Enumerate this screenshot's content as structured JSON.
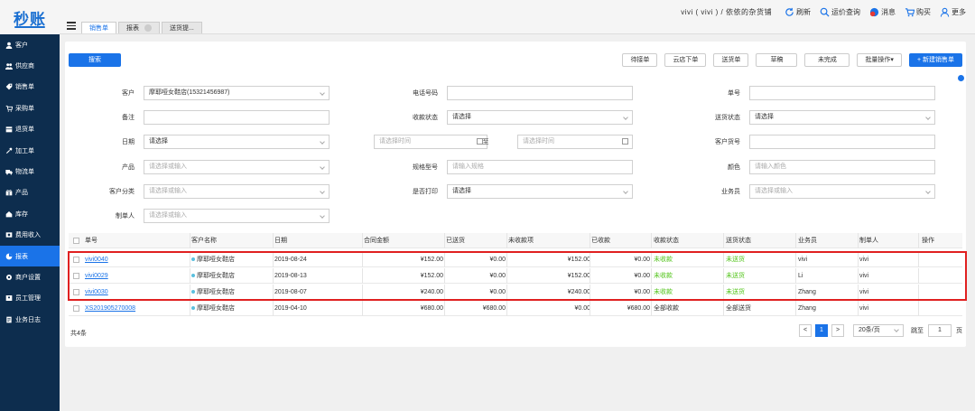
{
  "app": {
    "logo": "秒账",
    "tabs": [
      {
        "label": "销售单"
      },
      {
        "label": "报表"
      },
      {
        "label": "送货提..."
      }
    ]
  },
  "topbar": {
    "user": "vivi ( vivi ) / 依依的杂货铺",
    "refresh": "刷新",
    "freight": "运价查询",
    "messages": "消息",
    "cart": "购买",
    "more": "更多"
  },
  "sidebar": {
    "items": [
      {
        "label": "客户",
        "icon": "user-icon"
      },
      {
        "label": "供应商",
        "icon": "users-icon"
      },
      {
        "label": "销售单",
        "icon": "tag-icon"
      },
      {
        "label": "采购单",
        "icon": "cart-icon"
      },
      {
        "label": "退货单",
        "icon": "box-icon"
      },
      {
        "label": "加工单",
        "icon": "tool-icon"
      },
      {
        "label": "物流单",
        "icon": "truck-icon"
      },
      {
        "label": "产品",
        "icon": "gift-icon"
      },
      {
        "label": "库存",
        "icon": "home-icon"
      },
      {
        "label": "费用收入",
        "icon": "money-icon"
      },
      {
        "label": "报表",
        "icon": "chart-icon"
      },
      {
        "label": "商户设置",
        "icon": "gear-icon"
      },
      {
        "label": "员工管理",
        "icon": "staff-icon"
      },
      {
        "label": "业务日志",
        "icon": "log-icon"
      }
    ],
    "active_index": 10
  },
  "toolbar": {
    "search": "搜索",
    "pending": "待接单",
    "cloud": "云店下单",
    "delivery": "送货单",
    "draft": "草稿",
    "unfinished": "未完成",
    "batch": "批量操作▾",
    "create": "+ 新建销售单"
  },
  "filters": {
    "customer_label": "客户",
    "customer_value": "摩耶哑女鞋店(15321456987)",
    "phone_label": "电话号码",
    "order_label": "单号",
    "remark_label": "备注",
    "payment_label": "收款状态",
    "payment_value": "请选择",
    "delivery_label": "送货状态",
    "delivery_value": "请选择",
    "date_label": "日期",
    "date_value": "请选择",
    "start_placeholder": "请选择时间",
    "to": "至",
    "end_placeholder": "请选择时间",
    "cust_order_label": "客户货号",
    "product_label": "产品",
    "product_placeholder": "请选择或输入",
    "spec_label": "规格型号",
    "spec_placeholder": "请输入规格",
    "color_label": "颜色",
    "color_placeholder": "请输入颜色",
    "category_label": "客户分类",
    "category_placeholder": "请选择或输入",
    "printed_label": "是否打印",
    "printed_value": "请选择",
    "sales_label": "业务员",
    "sales_placeholder": "请选择或输入",
    "creator_label": "制单人",
    "creator_placeholder": "请选择或输入"
  },
  "table": {
    "headers": [
      "单号",
      "客户名称",
      "日期",
      "合同金额",
      "已送货",
      "未收款项",
      "已收款",
      "收款状态",
      "送货状态",
      "业务员",
      "制单人",
      "操作"
    ],
    "rows": [
      {
        "no": "vivi0040",
        "customer": "摩耶哑女鞋店",
        "date": "2019-08-24",
        "amount": "¥152.00",
        "delivered": "¥0.00",
        "unpaid": "¥152.00",
        "paid": "¥0.00",
        "pay_status": "未收款",
        "del_status": "未送货",
        "sales": "vivi",
        "creator": "vivi"
      },
      {
        "no": "vivi0029",
        "customer": "摩耶哑女鞋店",
        "date": "2019-08-13",
        "amount": "¥152.00",
        "delivered": "¥0.00",
        "unpaid": "¥152.00",
        "paid": "¥0.00",
        "pay_status": "未收款",
        "del_status": "未送货",
        "sales": "Li",
        "creator": "vivi"
      },
      {
        "no": "vivi0030",
        "customer": "摩耶哑女鞋店",
        "date": "2019-08-07",
        "amount": "¥240.00",
        "delivered": "¥0.00",
        "unpaid": "¥240.00",
        "paid": "¥0.00",
        "pay_status": "未收款",
        "del_status": "未送货",
        "sales": "Zhang",
        "creator": "vivi"
      },
      {
        "no": "XS201905270008",
        "customer": "摩耶哑女鞋店",
        "date": "2019-04-10",
        "amount": "¥680.00",
        "delivered": "¥680.00",
        "unpaid": "¥0.00",
        "paid": "¥680.00",
        "pay_status": "全部收款",
        "del_status": "全部送货",
        "sales": "Zhang",
        "creator": "vivi"
      }
    ]
  },
  "footer": {
    "count": "共4条",
    "prev": "<",
    "page": "1",
    "next": ">",
    "per_page": "20条/页",
    "goto_label": "跳至",
    "goto_value": "1",
    "page_suffix": "页"
  },
  "colors": {
    "accent": "#1a73e8",
    "sidebar": "#0d2d4e",
    "highlight": "#e02020",
    "green": "#52c41a"
  }
}
